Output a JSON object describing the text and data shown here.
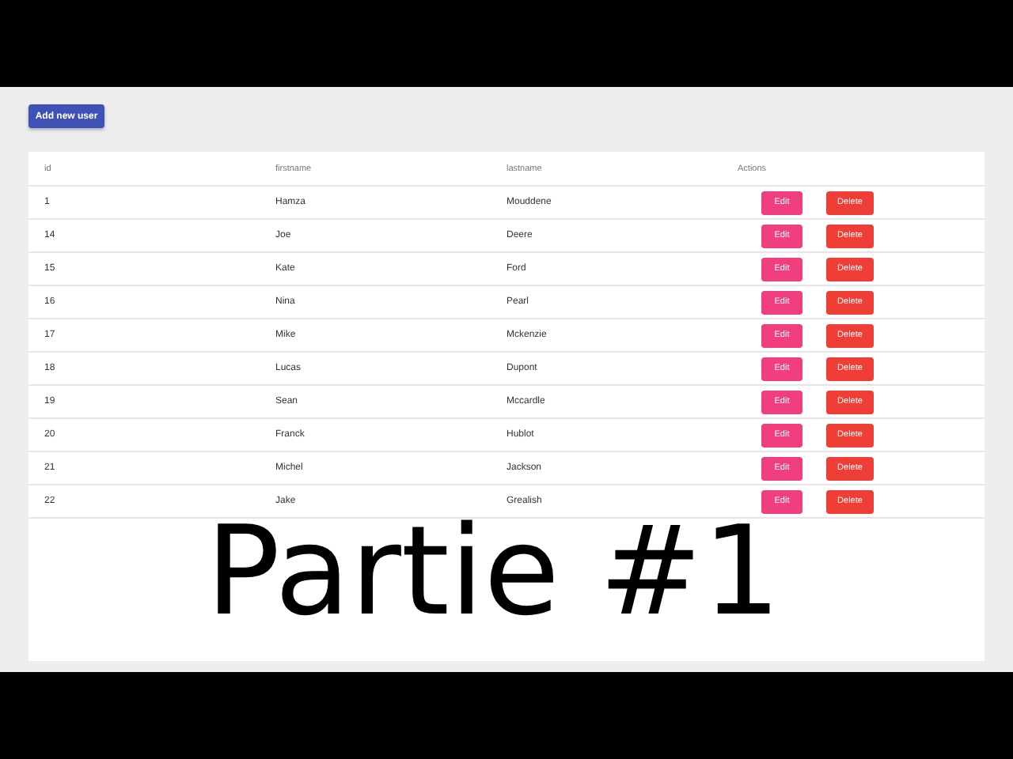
{
  "add_button": "Add new user",
  "table": {
    "columns": [
      "id",
      "firstname",
      "lastname",
      "Actions"
    ],
    "rows": [
      {
        "id": "1",
        "firstname": "Hamza",
        "lastname": "Mouddene",
        "actions": [
          "Edit",
          "Delete"
        ]
      },
      {
        "id": "14",
        "firstname": "Joe",
        "lastname": "Deere",
        "actions": [
          "Edit",
          "Delete"
        ]
      },
      {
        "id": "15",
        "firstname": "Kate",
        "lastname": "Ford",
        "actions": [
          "Edit",
          "Delete"
        ]
      },
      {
        "id": "16",
        "firstname": "Nina",
        "lastname": "Pearl",
        "actions": [
          "Edit",
          "Delete"
        ]
      },
      {
        "id": "17",
        "firstname": "Mike",
        "lastname": "Mckenzie",
        "actions": [
          "Edit",
          "Delete"
        ]
      },
      {
        "id": "18",
        "firstname": "Lucas",
        "lastname": "Dupont",
        "actions": [
          "Edit",
          "Delete"
        ]
      },
      {
        "id": "19",
        "firstname": "Sean",
        "lastname": "Mccardle",
        "actions": [
          "Edit",
          "Delete"
        ]
      },
      {
        "id": "20",
        "firstname": "Franck",
        "lastname": "Hublot",
        "actions": [
          "Edit",
          "Delete"
        ]
      },
      {
        "id": "21",
        "firstname": "Michel",
        "lastname": "Jackson",
        "actions": [
          "Edit",
          "Delete"
        ]
      },
      {
        "id": "22",
        "firstname": "Jake",
        "lastname": "Grealish",
        "actions": [
          "Edit",
          "Delete"
        ]
      }
    ]
  },
  "overlay_title": "Partie #1"
}
